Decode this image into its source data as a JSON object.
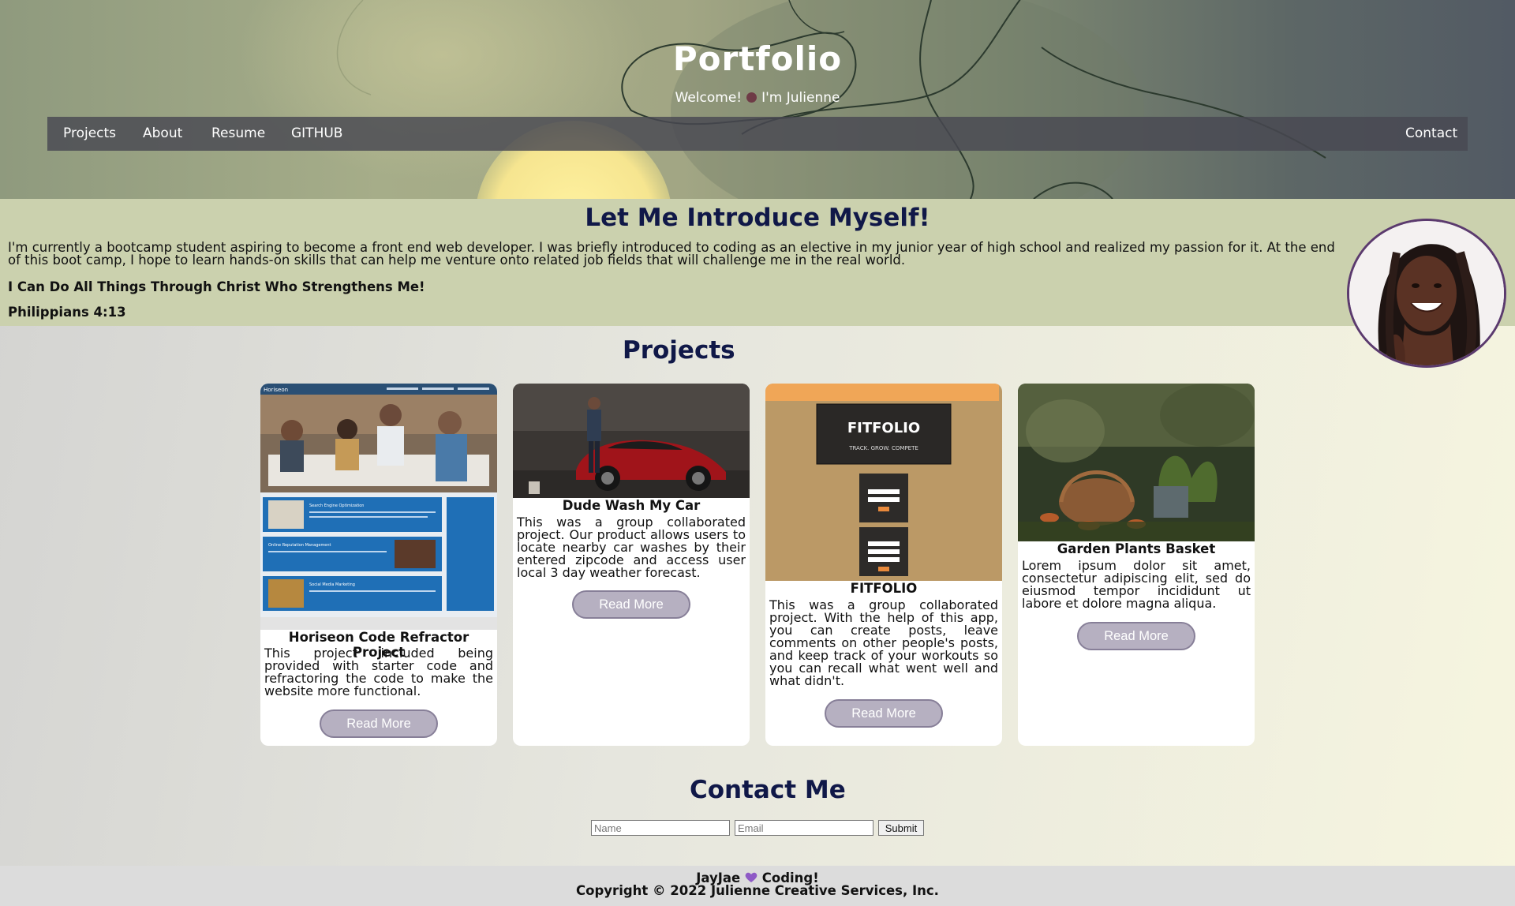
{
  "header": {
    "title": "Portfolio",
    "subtitle_before": "Welcome!",
    "subtitle_after": "I'm Julienne",
    "nav": {
      "projects": "Projects",
      "about": "About",
      "resume": "Resume",
      "github": "GITHUB",
      "contact": "Contact"
    }
  },
  "intro": {
    "heading": "Let Me Introduce Myself!",
    "paragraph": "I'm currently a bootcamp student aspiring to become a front end web developer. I was briefly introduced to coding as an elective in my junior year of high school and realized my passion for it. At the end of this boot camp, I hope to learn hands-on skills that can help me venture onto related job fields that will challenge me in the real world.",
    "quote": "I Can Do All Things Through Christ Who Strengthens Me!",
    "reference": "Philippians 4:13"
  },
  "projects": {
    "heading": "Projects",
    "read_more": "Read More",
    "items": [
      {
        "title": "Horiseon Code Refractor Project",
        "description": "This project included being provided with starter code and refractoring the code to make the website more functional.",
        "thumb_header": "Horiseon",
        "thumb_sections": [
          "Search Engine Optimization",
          "Online Reputation Management",
          "Social Media Marketing"
        ]
      },
      {
        "title": "Dude Wash My Car",
        "description": "This was a group collaborated project. Our product allows users to locate nearby car washes by their entered zipcode and access user local 3 day weather forecast."
      },
      {
        "title": "FITFOLIO",
        "description": "This was a group collaborated project. With the help of this app, you can create posts, leave comments on other people's posts, and keep track of your workouts so you can recall what went well and what didn't.",
        "thumb_logo": "FITFOLIO",
        "thumb_tagline": "TRACK. GROW. COMPETE"
      },
      {
        "title": "Garden Plants Basket",
        "description": "Lorem ipsum dolor sit amet, consectetur adipiscing elit, sed do eiusmod tempor incididunt ut labore et dolore magna aliqua."
      }
    ]
  },
  "contact": {
    "heading": "Contact Me",
    "name_placeholder": "Name",
    "email_placeholder": "Email",
    "submit": "Submit"
  },
  "footer": {
    "line1_before": "JayJae",
    "line1_after": "Coding!",
    "copyright": "Copyright © 2022 Julienne Creative Services, Inc."
  },
  "colors": {
    "heading_navy": "#101848",
    "intro_band": "#cbd1ae",
    "button_fill": "#b6b0c1",
    "nav_bar": "#484852",
    "heart": "#8e5ac6"
  }
}
